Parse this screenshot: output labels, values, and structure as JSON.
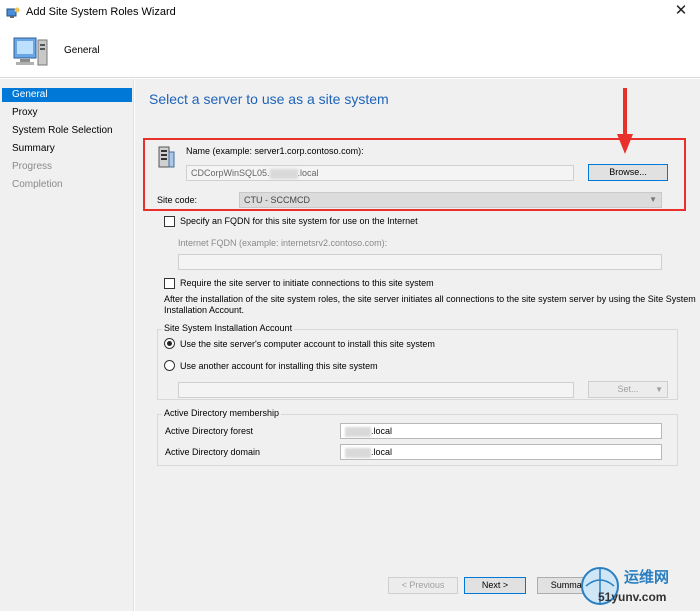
{
  "window": {
    "title": "Add Site System Roles Wizard"
  },
  "header": {
    "label": "General"
  },
  "nav": {
    "items": [
      {
        "label": "General",
        "state": "active"
      },
      {
        "label": "Proxy",
        "state": "normal"
      },
      {
        "label": "System Role Selection",
        "state": "normal"
      },
      {
        "label": "Summary",
        "state": "normal"
      },
      {
        "label": "Progress",
        "state": "disabled"
      },
      {
        "label": "Completion",
        "state": "disabled"
      }
    ]
  },
  "page": {
    "title": "Select a server to use as a site system",
    "name_label": "Name (example: server1.corp.contoso.com):",
    "name_value_prefix": "CDCorpWinSQL05.",
    "name_value_suffix": ".local",
    "browse_label": "Browse...",
    "site_code_label": "Site code:",
    "site_code_value": "CTU - SCCMCD",
    "fqdn_checkbox_label": "Specify an FQDN for this site system for use on the Internet",
    "fqdn_label": "Internet FQDN (example: internetsrv2.contoso.com):",
    "require_checkbox_label": "Require the site server to initiate connections to this site system",
    "require_desc_line1": "After the  installation of the site system roles, the site server initiates all connections to the site system server by using the Site System",
    "require_desc_line2": "Installation Account.",
    "install_group_title": "Site System Installation Account",
    "radio_computer_account": "Use the site server's computer account to install this site system",
    "radio_another_account": "Use another account for installing this site system",
    "set_button": "Set...",
    "ad_group_title": "Active Directory membership",
    "ad_forest_label": "Active Directory forest",
    "ad_forest_value_suffix": ".local",
    "ad_domain_label": "Active Directory domain",
    "ad_domain_value_suffix": ".local"
  },
  "footer": {
    "previous": "< Previous",
    "next": "Next >",
    "summary": "Summary"
  },
  "watermark": {
    "line1": "运维网",
    "line2": "51yunv.com"
  },
  "colors": {
    "accent": "#0078d7",
    "title_blue": "#1e63b8",
    "highlight_red": "#e8312a"
  }
}
